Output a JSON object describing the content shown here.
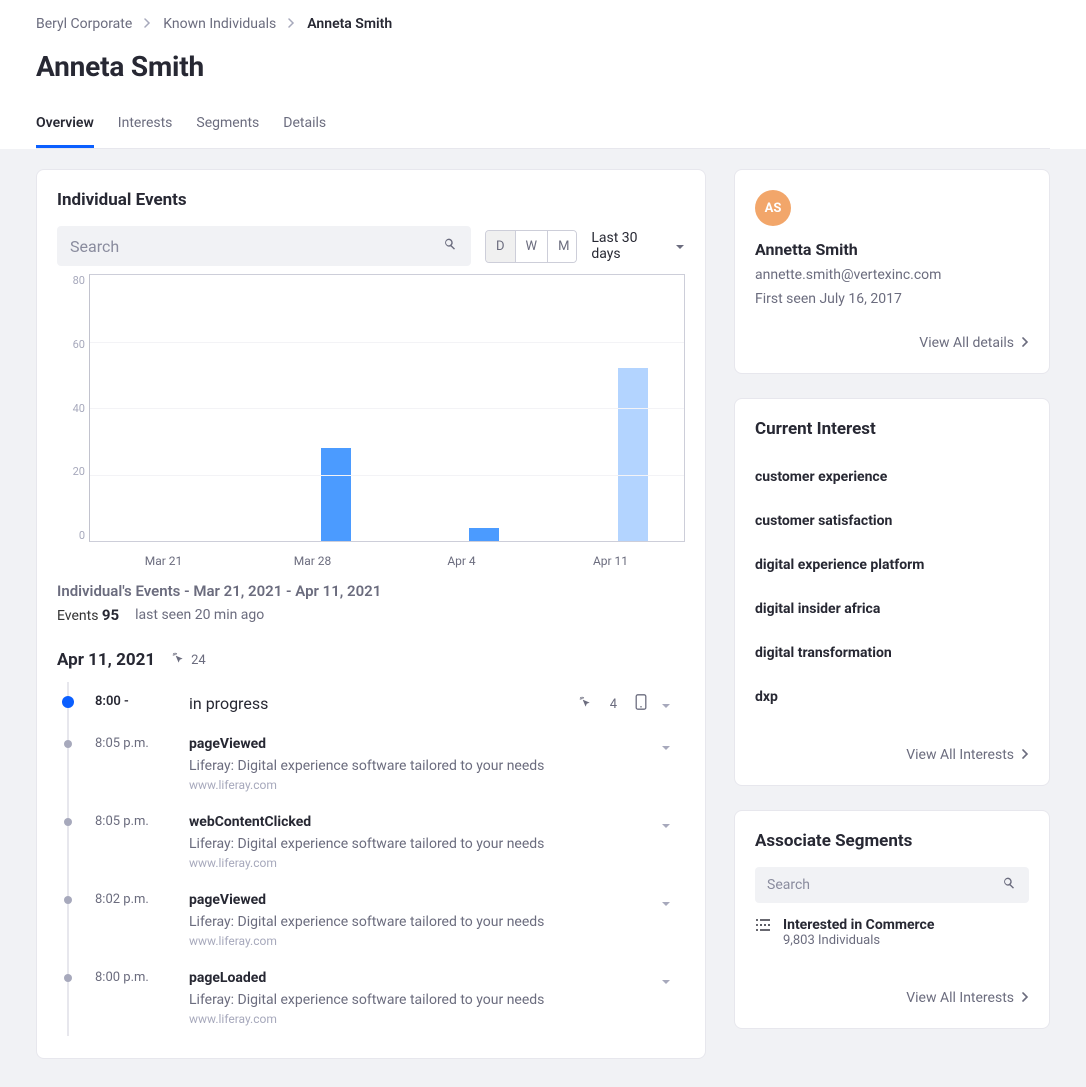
{
  "breadcrumb": {
    "root": "Beryl Corporate",
    "section": "Known Individuals",
    "current": "Anneta Smith"
  },
  "page_title": "Anneta Smith",
  "tabs": [
    "Overview",
    "Interests",
    "Segments",
    "Details"
  ],
  "events_card": {
    "title": "Individual Events",
    "search_placeholder": "Search",
    "granularity": [
      "D",
      "W",
      "M"
    ],
    "range_label": "Last 30 days",
    "caption": "Individual's Events - Mar 21, 2021 - Apr 11, 2021",
    "events_label": "Events",
    "events_count": "95",
    "last_seen": "last seen 20 min ago"
  },
  "chart_data": {
    "type": "bar",
    "categories": [
      "Mar 21",
      "Mar 28",
      "Apr 4",
      "Apr 11"
    ],
    "series": [
      {
        "name": "events-dark",
        "color": "#4B9BFF",
        "values": [
          0,
          28,
          4,
          0
        ]
      },
      {
        "name": "events-light",
        "color": "#B3D4FF",
        "values": [
          0,
          0,
          0,
          52
        ]
      }
    ],
    "yticks": [
      80,
      60,
      40,
      20,
      0
    ],
    "ylim": [
      0,
      80
    ],
    "xlabel": "",
    "ylabel": "",
    "title": ""
  },
  "timeline": {
    "date": "Apr 11, 2021",
    "day_count": "24",
    "session": {
      "time": "8:00 -",
      "status": "in progress",
      "session_count": "4"
    },
    "items": [
      {
        "time": "8:05 p.m.",
        "event": "pageViewed",
        "desc": "Liferay: Digital experience software tailored to your needs",
        "url": "www.liferay.com"
      },
      {
        "time": "8:05 p.m.",
        "event": "webContentClicked",
        "desc": "Liferay: Digital experience software tailored to your needs",
        "url": "www.liferay.com"
      },
      {
        "time": "8:02 p.m.",
        "event": "pageViewed",
        "desc": "Liferay: Digital experience software tailored to your needs",
        "url": "www.liferay.com"
      },
      {
        "time": "8:00 p.m.",
        "event": "pageLoaded",
        "desc": "Liferay: Digital experience software tailored to your needs",
        "url": "www.liferay.com"
      }
    ]
  },
  "profile": {
    "initials": "AS",
    "name": "Annetta Smith",
    "email": "annette.smith@vertexinc.com",
    "first_seen": "First seen July 16, 2017",
    "view_all": "View All details"
  },
  "interests": {
    "title": "Current Interest",
    "items": [
      "customer experience",
      "customer satisfaction",
      "digital experience platform",
      "digital insider africa",
      "digital transformation",
      "dxp"
    ],
    "view_all": "View All Interests"
  },
  "segments": {
    "title": "Associate Segments",
    "search_placeholder": "Search",
    "item_title": "Interested in Commerce",
    "item_meta": "9,803 Individuals",
    "view_all": "View All Interests"
  }
}
